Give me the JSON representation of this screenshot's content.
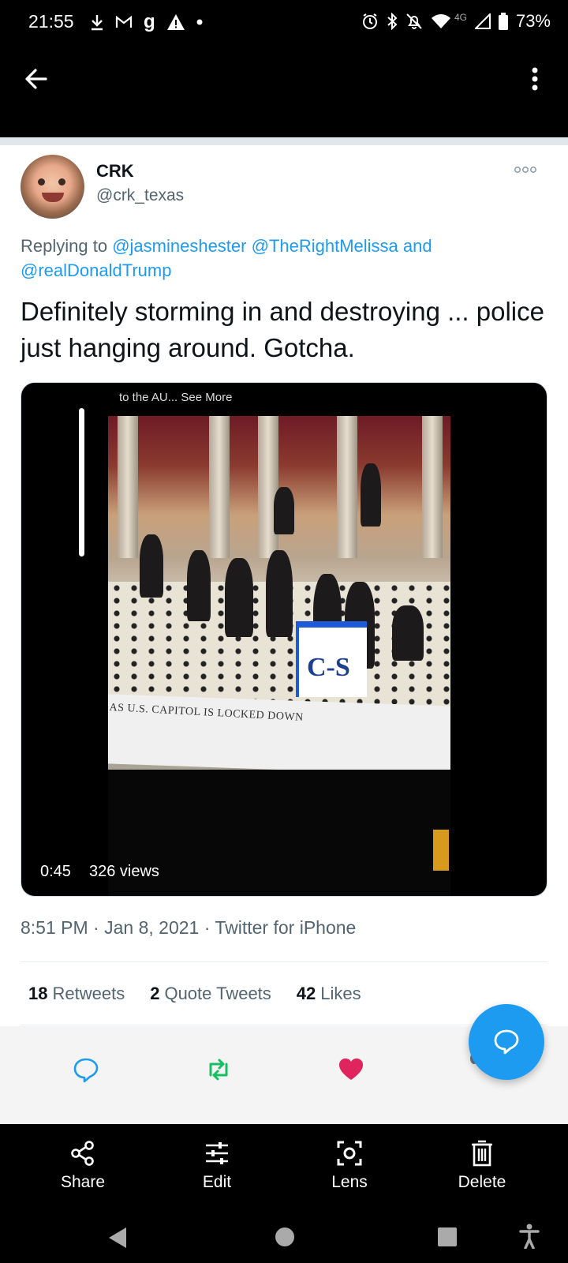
{
  "status_bar": {
    "time": "21:55",
    "battery": "73%",
    "network": "4G"
  },
  "tweet": {
    "author_name": "CRK",
    "author_handle": "@crk_texas",
    "replying_prefix": "Replying to ",
    "mention_1": "@jasmineshester",
    "mention_2": "@TheRightMelissa",
    "and_word": "and",
    "mention_3": "@realDonaldTrump",
    "text": "Definitely storming in and destroying ... police just hanging around. Gotcha.",
    "media": {
      "top_caption": "to the AU... See More",
      "chyron": "AS U.S. CAPITOL IS LOCKED DOWN",
      "logo_text": "C-S",
      "duration": "0:45",
      "views": "326 views"
    },
    "time": "8:51 PM",
    "date": "Jan 8, 2021",
    "source": "Twitter for iPhone",
    "stats": {
      "retweets_count": "18",
      "retweets_label": "Retweets",
      "quotes_count": "2",
      "quotes_label": "Quote Tweets",
      "likes_count": "42",
      "likes_label": "Likes"
    }
  },
  "toolbar": {
    "share": "Share",
    "edit": "Edit",
    "lens": "Lens",
    "delete": "Delete"
  },
  "colors": {
    "accent": "#1d9bf0",
    "retweet": "#17bf63",
    "like": "#e0245e"
  }
}
